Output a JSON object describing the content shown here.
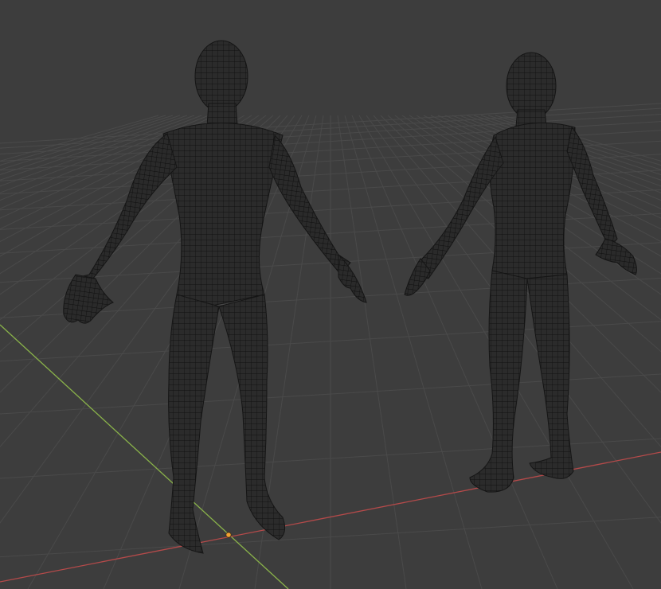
{
  "viewport": {
    "background_color": "#3d3d3d",
    "grid_color": "#4a4a4a",
    "x_axis_color": "#b54a4a",
    "y_axis_color": "#8ab34a",
    "origin_color": "#f2a133",
    "wire_color": "#111111",
    "body_fill_color": "#2b2b2b"
  },
  "scene": {
    "objects": [
      {
        "name": "human-mesh",
        "view": "front-three-quarter"
      },
      {
        "name": "human-mesh",
        "view": "rear-three-quarter"
      }
    ]
  },
  "icons": {
    "origin": "origin-marker-icon"
  }
}
